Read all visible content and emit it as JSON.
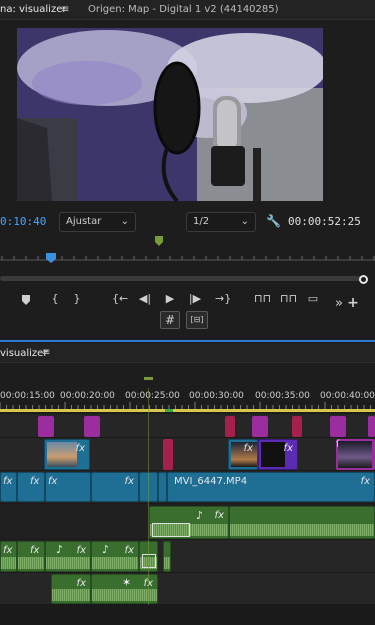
{
  "monitor": {
    "tab_active": "na: visualizer",
    "tab_menu_icon": "≡",
    "tab_source": "Origen: Map - Digital 1 v2 (44140285)",
    "current_timecode": "0:10:40",
    "fit_label": "Ajustar",
    "resolution_label": "1/2",
    "duration_timecode": "00:00:52:25"
  },
  "transport": {
    "buttons": [
      "marker-icon",
      "in-point-icon",
      "out-point-icon",
      "go-to-in-icon",
      "step-back-icon",
      "play-icon",
      "step-forward-icon",
      "go-to-out-icon",
      "lift-icon",
      "extract-icon",
      "export-frame-icon"
    ],
    "more_label": "»",
    "add_label": "+"
  },
  "timeline": {
    "tab_label": "visualizer",
    "tab_menu_icon": "≡",
    "ruler_labels": [
      "00:00:15:00",
      "00:00:20:00",
      "00:00:25:00",
      "00:00:30:00",
      "00:00:35:00",
      "00:00:40:00"
    ],
    "video_clip_name": "MVI_6447.MP4",
    "fx_label": "fx"
  },
  "colors": {
    "accent_blue": "#2e7bd6",
    "clip_video": "#1f6e93",
    "clip_audio": "#3a6e2f",
    "clip_purple": "#9b2d9f",
    "clip_magenta": "#a5204c",
    "playhead_green": "#7a9a3a",
    "work_area_yellow": "#d8c74a"
  }
}
